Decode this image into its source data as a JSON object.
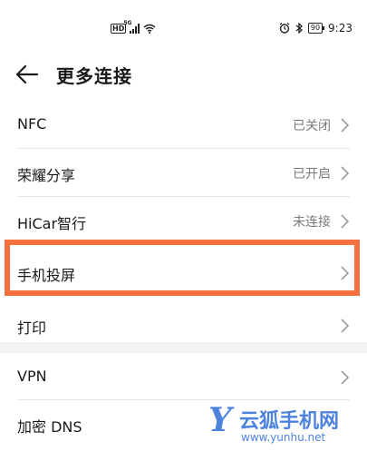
{
  "status_bar": {
    "hd_label": "HD",
    "network_label": "5G",
    "battery": "90",
    "time": "9:23"
  },
  "header": {
    "title": "更多连接"
  },
  "list": [
    {
      "label": "NFC",
      "value": "已关闭"
    },
    {
      "label": "荣耀分享",
      "value": "已开启"
    },
    {
      "label": "HiCar智行",
      "value": "未连接"
    },
    {
      "label": "手机投屏",
      "value": ""
    },
    {
      "label": "打印",
      "value": ""
    }
  ],
  "list2": [
    {
      "label": "VPN",
      "value": ""
    },
    {
      "label": "加密 DNS",
      "value": ""
    }
  ],
  "watermark": {
    "brand": "云狐手机网",
    "url": "www.yunhu.net"
  },
  "colors": {
    "highlight": "#f3703f",
    "watermark": "#2f6ed8"
  }
}
